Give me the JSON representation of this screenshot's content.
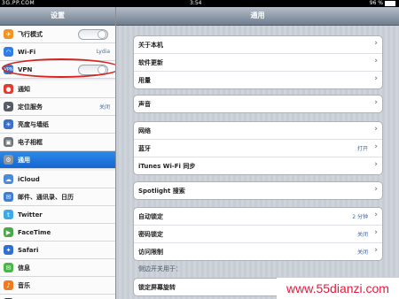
{
  "status_bar": {
    "watermark": "3G.PP.COM",
    "time": "3:54",
    "battery": "96 %"
  },
  "sidebar": {
    "title": "设置",
    "items": [
      {
        "label": "飞行模式",
        "icon": "airplane-icon",
        "color": "#f29324",
        "control": "toggle"
      },
      {
        "label": "Wi-Fi",
        "icon": "wifi-icon",
        "color": "#2f7ee6",
        "value": "Lydia"
      },
      {
        "label": "VPN",
        "icon": "vpn-icon",
        "color": "#3a73c9",
        "control": "toggle"
      },
      {
        "label": "通知",
        "icon": "notification-icon",
        "color": "#e23a2f"
      },
      {
        "label": "定位服务",
        "icon": "location-icon",
        "color": "#565d66",
        "value": "关闭"
      },
      {
        "label": "亮度与墙纸",
        "icon": "brightness-icon",
        "color": "#3a6fc8"
      },
      {
        "label": "电子相框",
        "icon": "picture-frame-icon",
        "color": "#6f7479"
      },
      {
        "label": "通用",
        "icon": "gear-icon",
        "color": "#8e959c",
        "selected": true
      },
      {
        "label": "iCloud",
        "icon": "cloud-icon",
        "color": "#4a8ad8"
      },
      {
        "label": "邮件、通讯录、日历",
        "icon": "mail-icon",
        "color": "#3d7fd6"
      },
      {
        "label": "Twitter",
        "icon": "twitter-icon",
        "color": "#3fa9e6"
      },
      {
        "label": "FaceTime",
        "icon": "facetime-icon",
        "color": "#4aa84a"
      },
      {
        "label": "Safari",
        "icon": "compass-icon",
        "color": "#2f6fcf"
      },
      {
        "label": "信息",
        "icon": "messages-icon",
        "color": "#47b847"
      },
      {
        "label": "音乐",
        "icon": "music-icon",
        "color": "#f07a1d"
      },
      {
        "label": "视频",
        "icon": "video-icon",
        "color": "#3a3f46"
      }
    ]
  },
  "main": {
    "title": "通用",
    "groups": [
      {
        "rows": [
          {
            "label": "关于本机"
          },
          {
            "label": "软件更新"
          },
          {
            "label": "用量"
          }
        ]
      },
      {
        "rows": [
          {
            "label": "声音"
          }
        ]
      },
      {
        "rows": [
          {
            "label": "网络"
          },
          {
            "label": "蓝牙",
            "value": "打开"
          },
          {
            "label": "iTunes Wi-Fi 同步"
          }
        ]
      },
      {
        "rows": [
          {
            "label": "Spotlight 搜索"
          }
        ]
      },
      {
        "rows": [
          {
            "label": "自动锁定",
            "value": "2 分钟"
          },
          {
            "label": "密码锁定",
            "value": "关闭"
          },
          {
            "label": "访问限制",
            "value": "关闭"
          }
        ]
      },
      {
        "rows": [
          {
            "label": "锁定屏幕旋转"
          }
        ]
      }
    ],
    "side_switch_label": "侧边开关用于：",
    "chevron": "›"
  },
  "watermark": "www.55dianzi.com",
  "accent_color": "#1a6cd6",
  "annotation_color": "#d8221d"
}
